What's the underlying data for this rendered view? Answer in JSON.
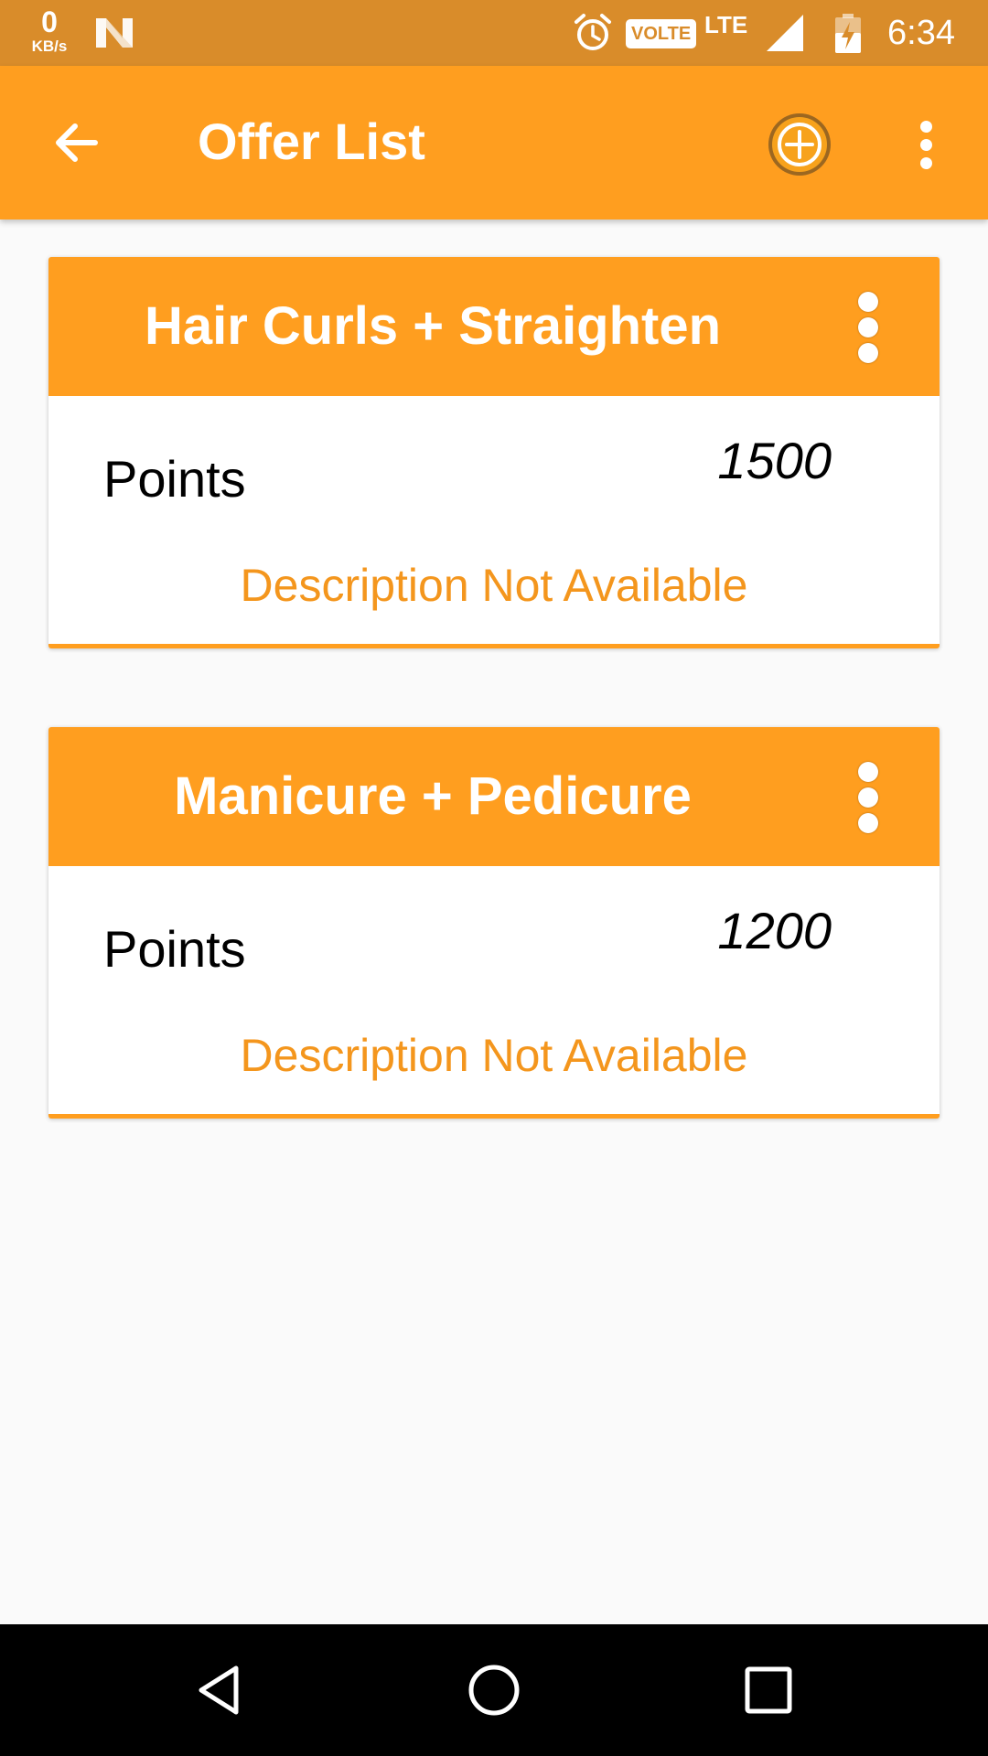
{
  "status_bar": {
    "net_speed_value": "0",
    "net_speed_unit": "KB/s",
    "volte_label": "VOLTE",
    "network_type": "LTE",
    "time": "6:34",
    "icons": [
      "n-notification-icon",
      "alarm-icon",
      "signal-icon",
      "battery-charging-icon"
    ]
  },
  "app_bar": {
    "title": "Offer List",
    "back_icon": "arrow-back-icon",
    "add_icon": "add-circle-icon",
    "overflow_icon": "more-vert-icon"
  },
  "offers": [
    {
      "title": "Hair Curls + Straighten",
      "points_label": "Points",
      "points": "1500",
      "description": "Description Not Available"
    },
    {
      "title": "Manicure + Pedicure",
      "points_label": "Points",
      "points": "1200",
      "description": "Description Not Available"
    }
  ],
  "nav_bar": {
    "icons": [
      "nav-back-icon",
      "nav-home-icon",
      "nav-recents-icon"
    ]
  },
  "colors": {
    "status_bar": "#d98c2a",
    "app_bar": "#ff9e1f",
    "card_header": "#ff9e1f",
    "description_text": "#f4961d",
    "background": "#fafafa",
    "nav_bar": "#000000"
  }
}
